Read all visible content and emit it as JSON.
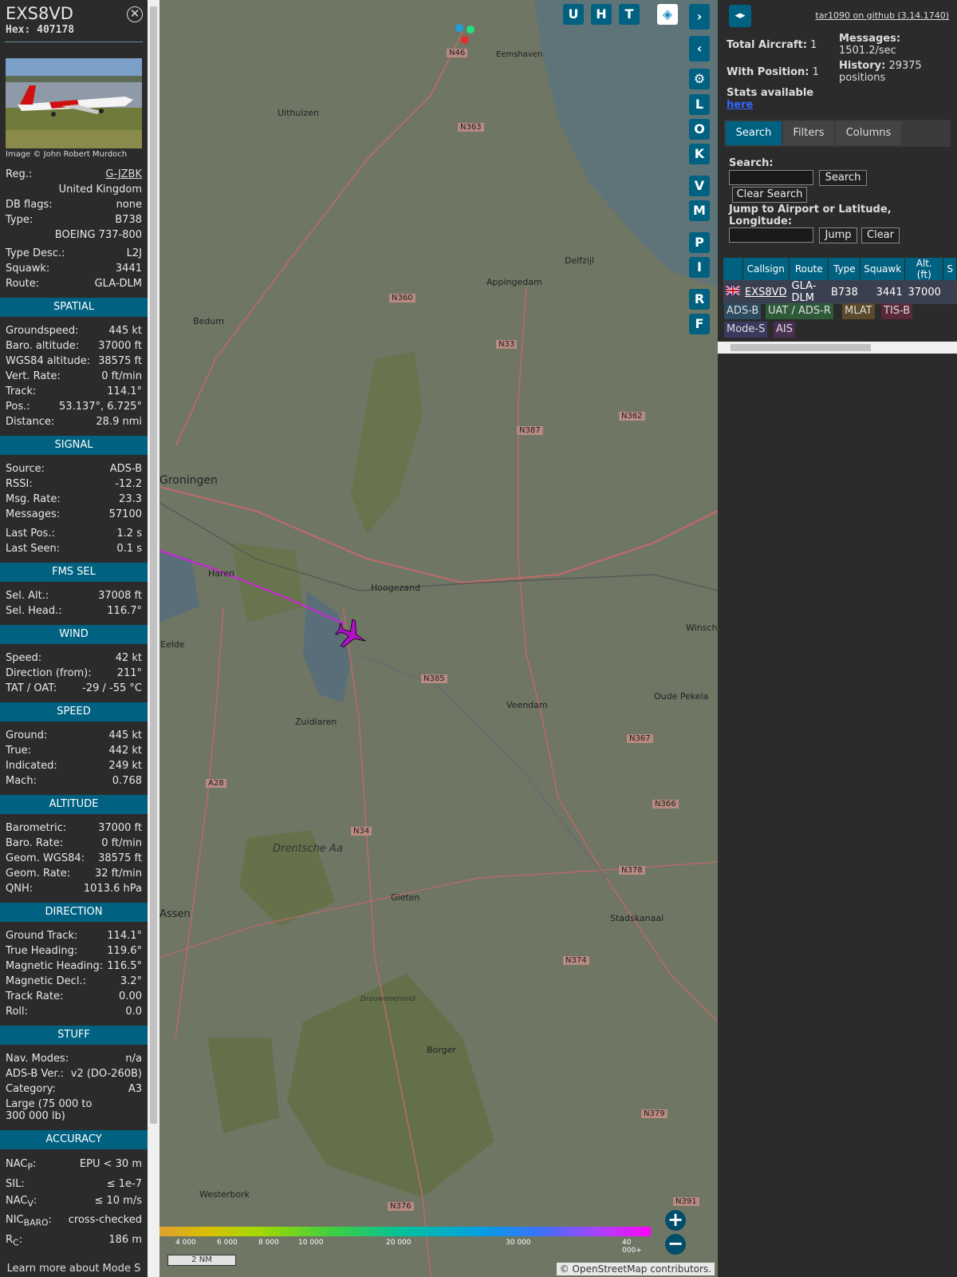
{
  "aircraft": {
    "callsign": "EXS8VD",
    "hex_label": "Hex: 407178",
    "photo_credit": "Image © John Robert Murdoch",
    "reg_label": "Reg.:",
    "reg_value": "G-JZBK",
    "country": "United Kingdom",
    "dbflags_label": "DB flags:",
    "dbflags_value": "none",
    "type_label": "Type:",
    "type_value": "B738",
    "type_full": "BOEING 737-800",
    "typedesc_label": "Type Desc.:",
    "typedesc_value": "L2J",
    "squawk_label": "Squawk:",
    "squawk_value": "3441",
    "route_label": "Route:",
    "route_value": "GLA-DLM"
  },
  "sections": {
    "spatial": {
      "title": "SPATIAL",
      "rows": [
        {
          "k": "Groundspeed:",
          "v": "445 kt"
        },
        {
          "k": "Baro. altitude:",
          "v": "37000 ft"
        },
        {
          "k": "WGS84 altitude:",
          "v": "38575 ft"
        },
        {
          "k": "Vert. Rate:",
          "v": "0 ft/min"
        },
        {
          "k": "Track:",
          "v": "114.1°"
        },
        {
          "k": "Pos.:",
          "v": "53.137°, 6.725°"
        },
        {
          "k": "Distance:",
          "v": "28.9 nmi"
        }
      ]
    },
    "signal": {
      "title": "SIGNAL",
      "rows": [
        {
          "k": "Source:",
          "v": "ADS-B"
        },
        {
          "k": "RSSI:",
          "v": "-12.2"
        },
        {
          "k": "Msg. Rate:",
          "v": "23.3"
        },
        {
          "k": "Messages:",
          "v": "57100"
        },
        {
          "k": "Last Pos.:",
          "v": "1.2 s"
        },
        {
          "k": "Last Seen:",
          "v": "0.1 s"
        }
      ]
    },
    "fms": {
      "title": "FMS SEL",
      "rows": [
        {
          "k": "Sel. Alt.:",
          "v": "37008 ft"
        },
        {
          "k": "Sel. Head.:",
          "v": "116.7°"
        }
      ]
    },
    "wind": {
      "title": "WIND",
      "rows": [
        {
          "k": "Speed:",
          "v": "42 kt"
        },
        {
          "k": "Direction (from):",
          "v": "211°"
        },
        {
          "k": "TAT / OAT:",
          "v": "-29 / -55 °C"
        }
      ]
    },
    "speed": {
      "title": "SPEED",
      "rows": [
        {
          "k": "Ground:",
          "v": "445 kt"
        },
        {
          "k": "True:",
          "v": "442 kt"
        },
        {
          "k": "Indicated:",
          "v": "249 kt"
        },
        {
          "k": "Mach:",
          "v": "0.768"
        }
      ]
    },
    "altitude": {
      "title": "ALTITUDE",
      "rows": [
        {
          "k": "Barometric:",
          "v": "37000 ft"
        },
        {
          "k": "Baro. Rate:",
          "v": "0 ft/min"
        },
        {
          "k": "Geom. WGS84:",
          "v": "38575 ft"
        },
        {
          "k": "Geom. Rate:",
          "v": "32 ft/min"
        },
        {
          "k": "QNH:",
          "v": "1013.6 hPa"
        }
      ]
    },
    "direction": {
      "title": "DIRECTION",
      "rows": [
        {
          "k": "Ground Track:",
          "v": "114.1°"
        },
        {
          "k": "True Heading:",
          "v": "119.6°"
        },
        {
          "k": "Magnetic Heading:",
          "v": "116.5°"
        },
        {
          "k": "Magnetic Decl.:",
          "v": "3.2°"
        },
        {
          "k": "Track Rate:",
          "v": "0.00"
        },
        {
          "k": "Roll:",
          "v": "0.0"
        }
      ]
    },
    "stuff": {
      "title": "STUFF",
      "rows": [
        {
          "k": "Nav. Modes:",
          "v": "n/a"
        },
        {
          "k": "ADS-B Ver.:",
          "v": "v2 (DO-260B)"
        },
        {
          "k": "Category:",
          "v": "A3"
        }
      ],
      "category_desc": "Large (75 000 to 300 000 lb)"
    },
    "accuracy": {
      "title": "ACCURACY",
      "nacp_k": "NAC",
      "nacp_sub": "P",
      "nacp_v": "EPU < 30 m",
      "sil_k": "SIL:",
      "sil_v": "≤ 1e-7",
      "nacv_k": "NAC",
      "nacv_sub": "V",
      "nacv_v": "≤ 10 m/s",
      "nic_k": "NIC",
      "nic_sub": "BARO",
      "nic_v": "cross-checked",
      "rc_k": "R",
      "rc_sub": "C",
      "rc_v": "186 m"
    },
    "footnote": "Learn more about Mode S data type by hovering over each data label."
  },
  "map": {
    "places": [
      "Eemshaven",
      "Uithuizen",
      "Appingedam",
      "Delfzijl",
      "Bedum",
      "Groningen",
      "Haren",
      "Hoogezand",
      "Eelde",
      "Zuidlaren",
      "Veendam",
      "Winschoten",
      "Oude Pekela",
      "Gieten",
      "Stadskanaal",
      "Borger",
      "Westerbork",
      "Assen",
      "Drentsche Aa",
      "Drouwenerveld"
    ],
    "roads": [
      "N46",
      "N363",
      "N360",
      "N33",
      "N387",
      "N362",
      "N385",
      "N367",
      "N366",
      "A28",
      "N34",
      "N378",
      "N374",
      "N379",
      "N376",
      "N391"
    ],
    "buttons": [
      "U",
      "H",
      "T",
      "L",
      "O",
      "K",
      "V",
      "M",
      "P",
      "I",
      "R",
      "F"
    ],
    "scale": "2 NM",
    "attribution": "© OpenStreetMap contributors.",
    "legend": [
      "4 000",
      "6 000",
      "8 000",
      "10 000",
      "20 000",
      "30 000",
      "40 000+"
    ],
    "zoom_in": "+",
    "zoom_out": "−"
  },
  "right": {
    "github": "tar1090 on github (3.14.1740)",
    "total_label": "Total Aircraft:",
    "total_value": "1",
    "withpos_label": "With Position:",
    "withpos_value": "1",
    "stats_label": "Stats available",
    "stats_link": "here",
    "messages_label": "Messages:",
    "messages_value": "1501.2/sec",
    "history_label": "History:",
    "history_value": "29375 positions",
    "tabs": [
      "Search",
      "Filters",
      "Columns"
    ],
    "search_label": "Search:",
    "search_btn": "Search",
    "clear_search_btn": "Clear Search",
    "jump_label": "Jump to Airport or Latitude, Longitude:",
    "jump_btn": "Jump",
    "clear_btn": "Clear",
    "table": {
      "headers": [
        "Callsign",
        "Route",
        "Type",
        "Squawk",
        "Alt. (ft)",
        "S"
      ],
      "row": [
        "EXS8VD",
        "GLA-DLM",
        "B738",
        "3441",
        "37000"
      ]
    },
    "sources": [
      "ADS-B",
      "UAT / ADS-R",
      "MLAT",
      "TIS-B",
      "Mode-S",
      "AIS"
    ]
  }
}
